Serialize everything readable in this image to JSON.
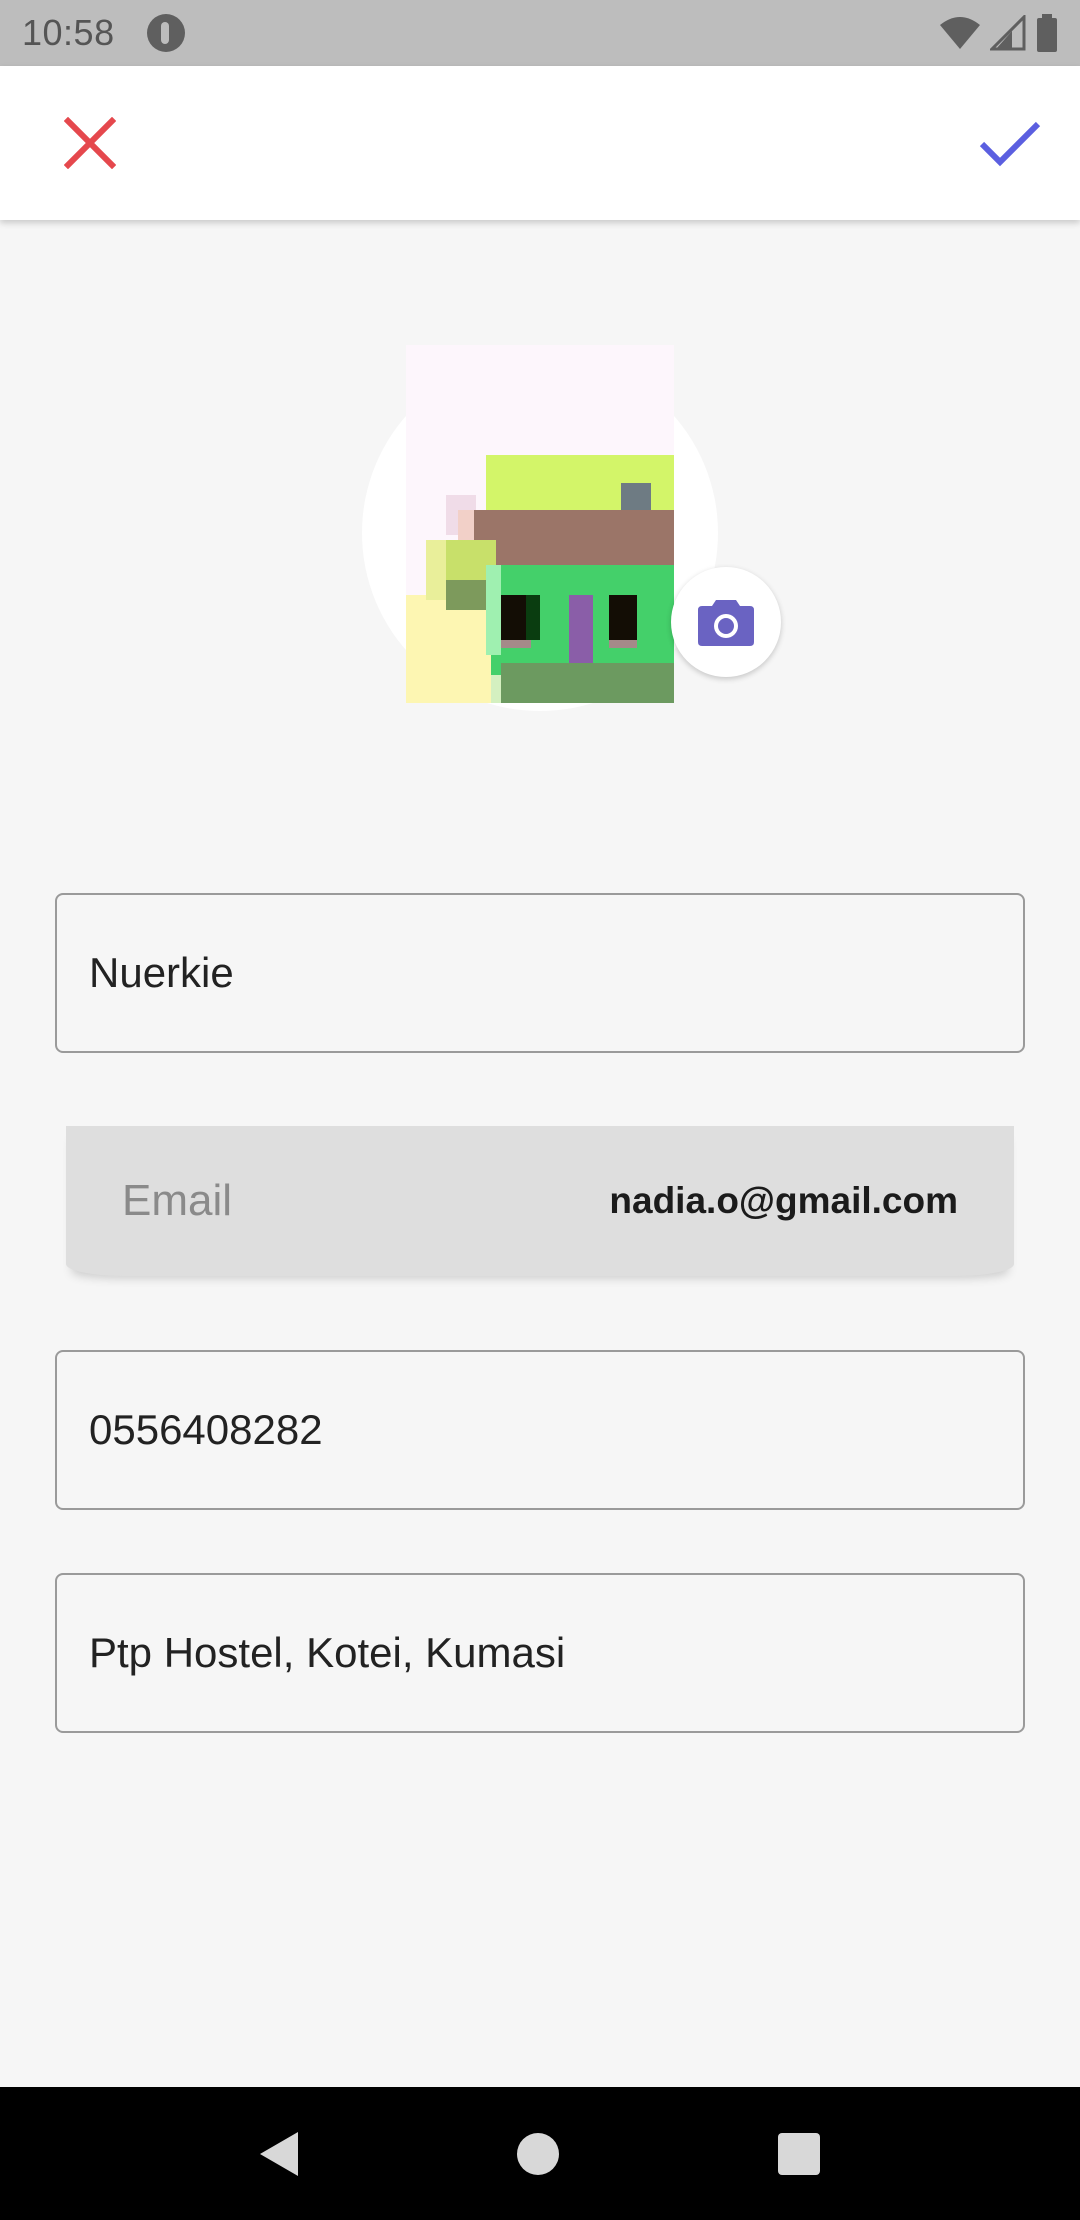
{
  "status_bar": {
    "time": "10:58",
    "icons": [
      "app-notification-icon",
      "wifi-icon",
      "cell-signal-icon",
      "battery-icon"
    ]
  },
  "app_bar": {
    "close_icon": "close-icon",
    "save_icon": "check-icon",
    "colors": {
      "close": "#e5484d",
      "check": "#5b5fe0"
    }
  },
  "profile": {
    "camera_icon": "camera-icon",
    "camera_color": "#6a63c2"
  },
  "form": {
    "name_value": "Nuerkie",
    "email_label": "Email",
    "email_value": "nadia.o@gmail.com",
    "phone_value": "0556408282",
    "address_value": "Ptp Hostel, Kotei, Kumasi"
  },
  "nav_bar": {
    "icons": [
      "back-icon",
      "home-icon",
      "recents-icon"
    ]
  }
}
